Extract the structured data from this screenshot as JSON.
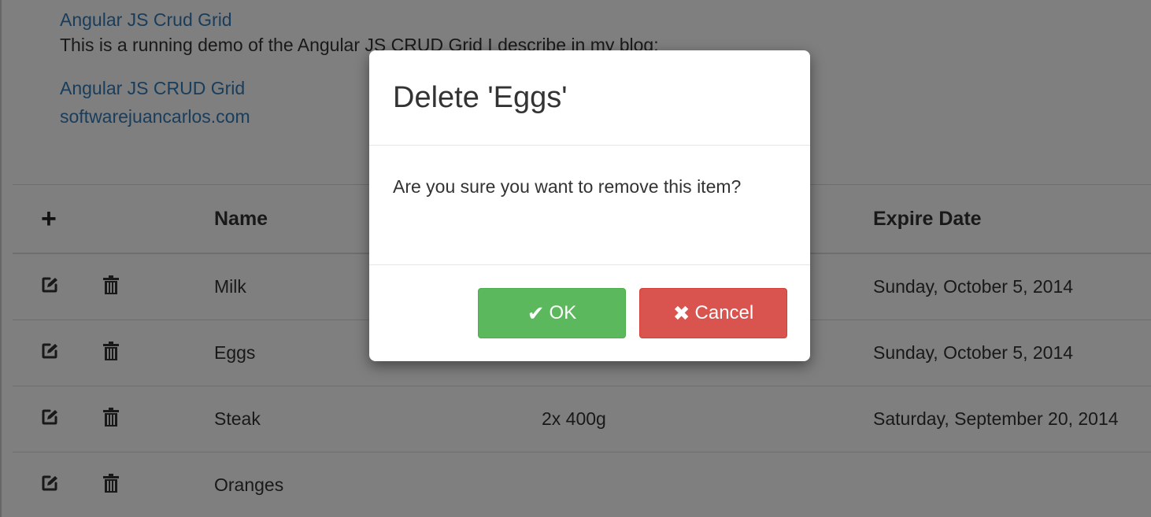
{
  "intro": {
    "title_link": "Angular JS Crud Grid",
    "description": "This is a running demo of the Angular JS CRUD Grid I describe in my blog:",
    "blog_title_link": "Angular JS CRUD Grid",
    "blog_site_link": "softwarejuancarlos.com"
  },
  "grid": {
    "add_icon": "plus-icon",
    "headers": {
      "name": "Name",
      "quantity": "",
      "expire_date": "Expire Date"
    },
    "rows": [
      {
        "name": "Milk",
        "quantity": "",
        "expire_date": "Sunday, October 5, 2014"
      },
      {
        "name": "Eggs",
        "quantity": "",
        "expire_date": "Sunday, October 5, 2014"
      },
      {
        "name": "Steak",
        "quantity": "2x 400g",
        "expire_date": "Saturday, September 20, 2014"
      },
      {
        "name": "Oranges",
        "quantity": "",
        "expire_date": ""
      }
    ],
    "row_icons": [
      "edit-icon",
      "trash-icon"
    ]
  },
  "modal": {
    "title": "Delete 'Eggs'",
    "body": "Are you sure you want to remove this item?",
    "ok_label": "OK",
    "cancel_label": "Cancel",
    "ok_icon": "checkmark-icon",
    "cancel_icon": "x-icon"
  },
  "colors": {
    "link": "#337ab7",
    "ok_button": "#5cb85c",
    "cancel_button": "#d9534f",
    "overlay": "rgba(0,0,0,0.5)"
  }
}
